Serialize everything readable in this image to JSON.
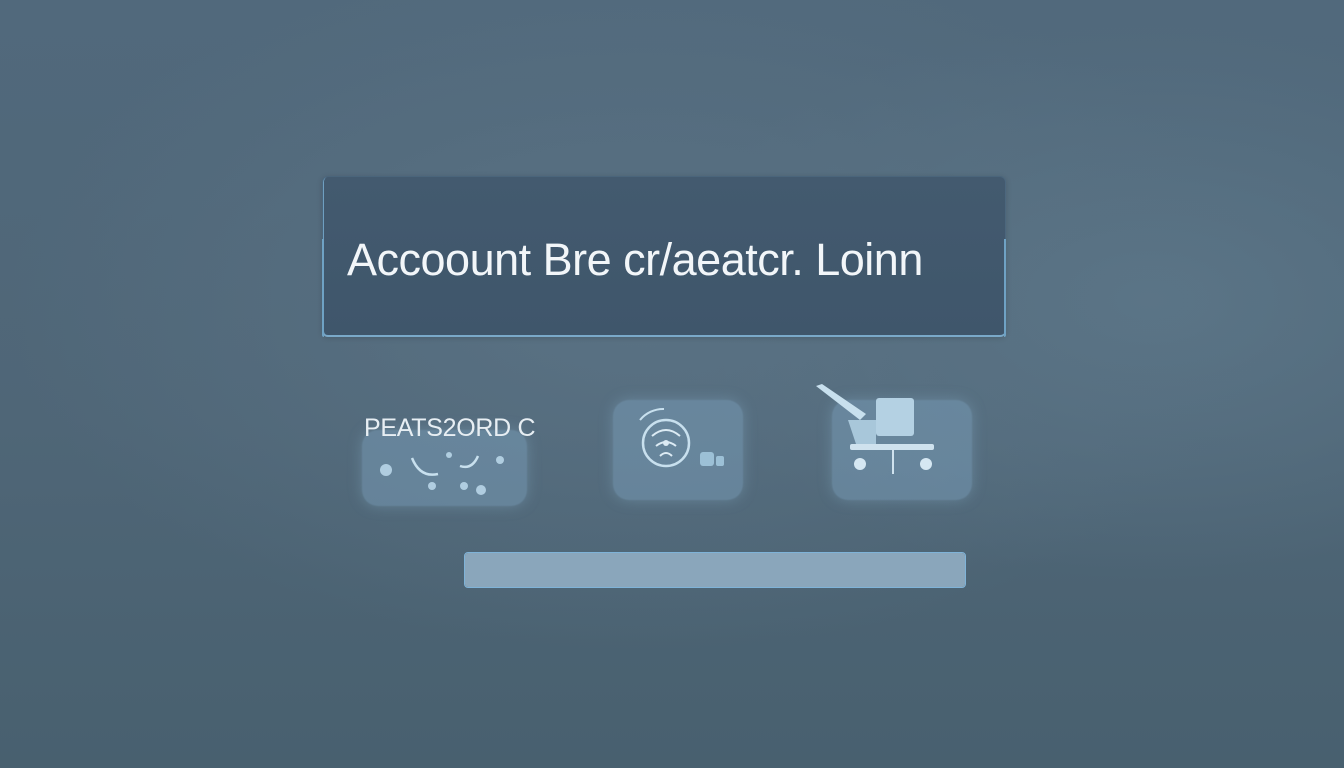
{
  "header": {
    "title": "Accoount Bre cr/aeatcr. Loinn"
  },
  "login_options": {
    "password_label": "PEATS2ORD C",
    "items": [
      {
        "icon": "password-dots-icon"
      },
      {
        "icon": "fingerprint-icon"
      },
      {
        "icon": "security-key-icon"
      }
    ]
  },
  "progress": {
    "value": 1.0
  },
  "colors": {
    "background": "#51697c",
    "panel": "#435a6f",
    "panel_border": "#6fa2c4",
    "text": "#f2f6f9",
    "tile": "#7ea5c0",
    "bar": "#879fb2",
    "bar_border": "#7fb3d8"
  }
}
